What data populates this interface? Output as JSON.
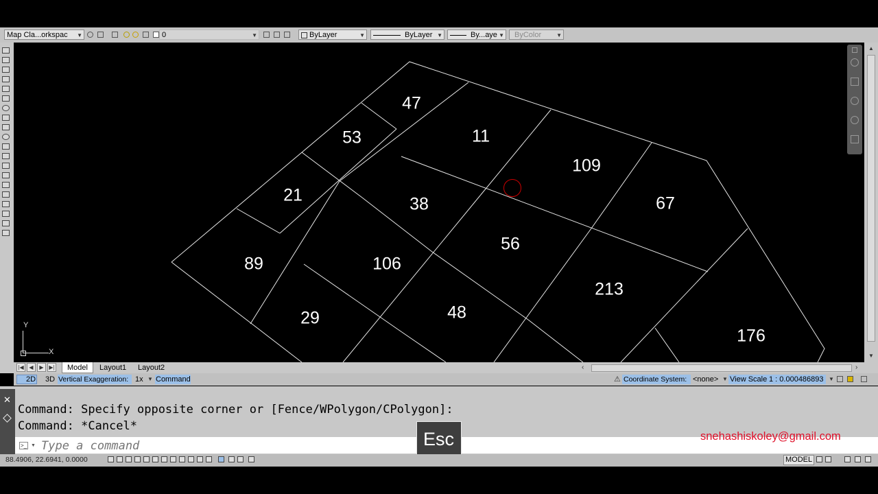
{
  "toolbar": {
    "workspace": "Map Cla...orkspac",
    "layer": "0",
    "color": "ByLayer",
    "linetype": "ByLayer",
    "lineweight": "By...aye",
    "plotstyle": "ByColor"
  },
  "viewport": {
    "parcels": [
      "47",
      "53",
      "11",
      "109",
      "21",
      "38",
      "67",
      "56",
      "89",
      "106",
      "213",
      "29",
      "48",
      "176"
    ],
    "ucs": {
      "x_label": "X",
      "y_label": "Y"
    }
  },
  "tabs": {
    "model": "Model",
    "layout1": "Layout1",
    "layout2": "Layout2"
  },
  "status": {
    "mode_2d": "2D",
    "mode_3d": "3D",
    "vertical_exaggeration_label": "Vertical Exaggeration:",
    "vertical_exaggeration_value": "1x",
    "command_label": "Command",
    "coordinate_system_label": "Coordinate System:",
    "coordinate_system_value": "<none>",
    "view_scale_label": "View Scale",
    "view_scale_value": "1 : 0.000486893"
  },
  "command": {
    "history": [
      "Command: Specify opposite corner or [Fence/WPolygon/CPolygon]:",
      "Command: *Cancel*"
    ],
    "placeholder": "Type a command",
    "close_glyph": "✕"
  },
  "overlay": {
    "key": "Esc",
    "email": "snehashiskoley@gmail.com"
  },
  "bottom": {
    "coordinates": "88.4906, 22.6941, 0.0000",
    "model_label": "MODEL"
  },
  "colors": {
    "canvas": "#000000",
    "panel": "#c8c8c8",
    "selection_highlight": "#cc0000",
    "email": "#e0102a"
  }
}
